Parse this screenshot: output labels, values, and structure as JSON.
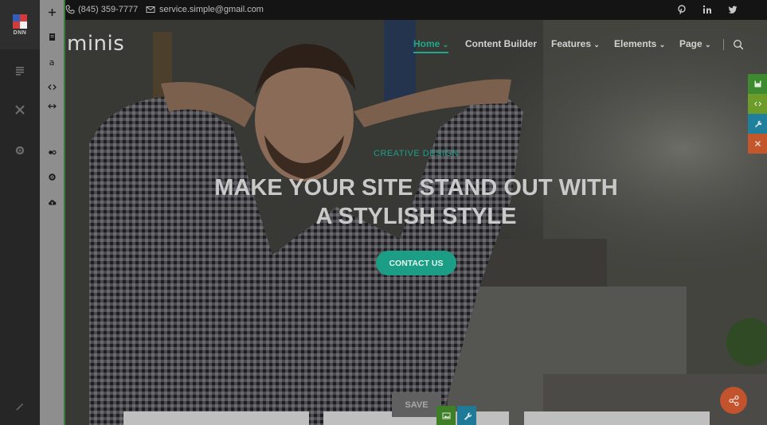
{
  "persona_bar": {
    "logo_label": "DNN",
    "icons": [
      "content-icon",
      "tools-icon",
      "settings-icon",
      "edit-pencil-icon"
    ]
  },
  "editor_tools": [
    "plus-icon",
    "page-icon",
    "text-icon",
    "code-icon",
    "swap-icon",
    "users-settings-icon",
    "gear-icon",
    "cloud-upload-icon"
  ],
  "editor_tools_text": {
    "text_glyph": "a"
  },
  "topbar": {
    "phone": "(845) 359-7777",
    "email": "service.simple@gmail.com",
    "social": [
      "pinterest-icon",
      "linkedin-icon",
      "twitter-icon"
    ]
  },
  "header": {
    "brand": "minis",
    "nav": [
      {
        "label": "Home",
        "caret": "⌄",
        "active": true
      },
      {
        "label": "Content Builder",
        "caret": "",
        "active": false
      },
      {
        "label": "Features",
        "caret": "⌄",
        "active": false
      },
      {
        "label": "Elements",
        "caret": "⌄",
        "active": false
      },
      {
        "label": "Page",
        "caret": "⌄",
        "active": false
      }
    ]
  },
  "hero": {
    "kicker": "CREATIVE DESIGN",
    "headline_line1": "MAKE YOUR SITE STAND OUT WITH",
    "headline_line2": "A STYLISH STYLE",
    "cta": "CONTACT US"
  },
  "edit_bar": {
    "save_label": "SAVE"
  },
  "colors": {
    "accent": "#1b9e85",
    "side_save": "#3d8b2e",
    "side_code": "#6e9c2a",
    "side_settings": "#1f7f9c",
    "side_close": "#c4562b",
    "share": "#c2532c"
  }
}
